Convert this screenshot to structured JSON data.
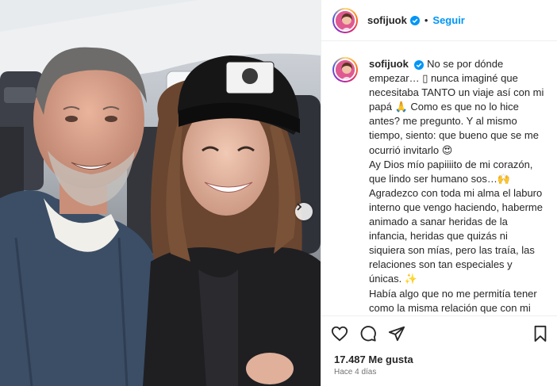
{
  "post": {
    "username": "sofijuok",
    "follow_label": "Seguir",
    "separator": "•",
    "caption_paragraphs": [
      "No se por dónde empezar… ▯ nunca imaginé que necesitaba TANTO un viaje así con mi papá 🙏 Como es que no lo hice antes? me pregunto. Y al mismo tiempo, siento: que bueno que se me ocurrió invitarlo 😍",
      "Ay Dios mío papiiiito de mi corazón, que lindo ser humano sos…🙌 Agradezco con toda mi alma el laburo interno que vengo haciendo, haberme animado a sanar heridas de la infancia, heridas que quizás ni siquiera son mías, pero las traía, las relaciones son tan especiales y únicas. ✨",
      "Había algo que no me permitía tener como la misma relación que con mi mamá, y si obvio son personas diferentes, que me generan cosas diferentes, pero que me aman con la misma intensidad, eso lo tengo"
    ],
    "likes": "17.487 Me gusta",
    "date": "Hace 4 días"
  },
  "icons": {
    "verified": "verified-badge-icon",
    "like": "heart-icon",
    "comment": "comment-icon",
    "share": "paper-plane-icon",
    "save": "bookmark-icon",
    "carousel": "chevron-right-icon"
  },
  "colors": {
    "accent": "#0095f6",
    "text": "#262626",
    "muted": "#737373",
    "border": "#efefef"
  }
}
